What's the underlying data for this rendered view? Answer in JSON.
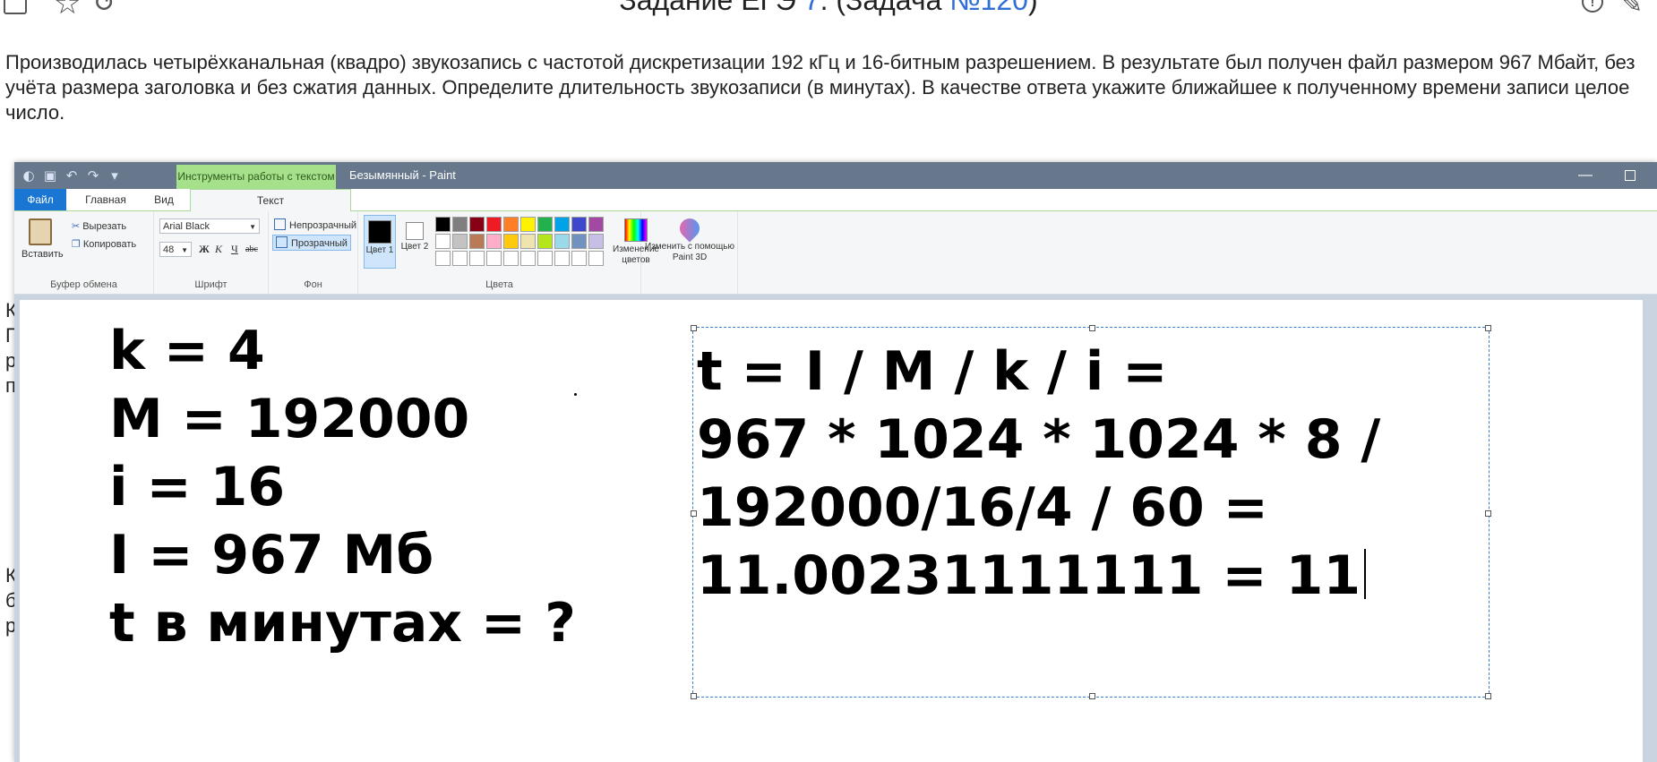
{
  "page": {
    "title_prefix": "Задание ЕГЭ ",
    "title_num": "7",
    "title_mid": ". (Задача ",
    "title_link": "№120",
    "title_suffix": ")",
    "task_text": "Производилась четырёхканальная (квадро) звукозапись с частотой дискретизации 192 кГц и 16-битным разрешением. В результате был получен файл размером 967 Мбайт, без учёта размера заголовка и без сжатия данных. Определите длительность звукозаписи (в минутах). В качестве ответа укажите ближайшее к полученному времени записи целое число.",
    "behind_letters": [
      "К",
      "П",
      "р",
      "п",
      "К",
      "б",
      "р"
    ]
  },
  "paint": {
    "context_tab": "Инструменты работы с текстом",
    "window_title": "Безымянный - Paint",
    "tabs": {
      "file": "Файл",
      "home": "Главная",
      "view": "Вид",
      "text": "Текст"
    },
    "clipboard": {
      "paste": "Вставить",
      "cut": "Вырезать",
      "copy": "Копировать",
      "group": "Буфер обмена"
    },
    "font": {
      "name": "Arial Black",
      "size": "48",
      "bold": "Ж",
      "italic": "К",
      "underline": "Ч",
      "strike": "abc",
      "group": "Шрифт"
    },
    "background": {
      "opaque": "Непрозрачный",
      "transparent": "Прозрачный",
      "group": "Фон"
    },
    "colors": {
      "color1": "Цвет 1",
      "color2": "Цвет 2",
      "edit": "Изменение цветов",
      "group": "Цвета",
      "palette": [
        "#000000",
        "#7f7f7f",
        "#880015",
        "#ed1c24",
        "#ff7f27",
        "#fff200",
        "#22b14c",
        "#00a2e8",
        "#3f48cc",
        "#a349a4",
        "#ffffff",
        "#c3c3c3",
        "#b97a57",
        "#ffaec9",
        "#ffc90e",
        "#efe4b0",
        "#b5e61d",
        "#99d9ea",
        "#7092be",
        "#c8bfe7",
        "#ffffff",
        "#ffffff",
        "#ffffff",
        "#ffffff",
        "#ffffff",
        "#ffffff",
        "#ffffff",
        "#ffffff",
        "#ffffff",
        "#ffffff"
      ]
    },
    "paint3d": "Изменить с помощью Paint 3D"
  },
  "canvas": {
    "left_lines": [
      "k = 4",
      "M = 192000",
      "i = 16",
      "I = 967 Мб",
      "t в минутах = ?"
    ],
    "right_lines": [
      "t = I / M / k / i =",
      "967 * 1024 * 1024 * 8 /",
      "192000/16/4 / 60 =",
      "11.00231111111 =  11"
    ]
  }
}
